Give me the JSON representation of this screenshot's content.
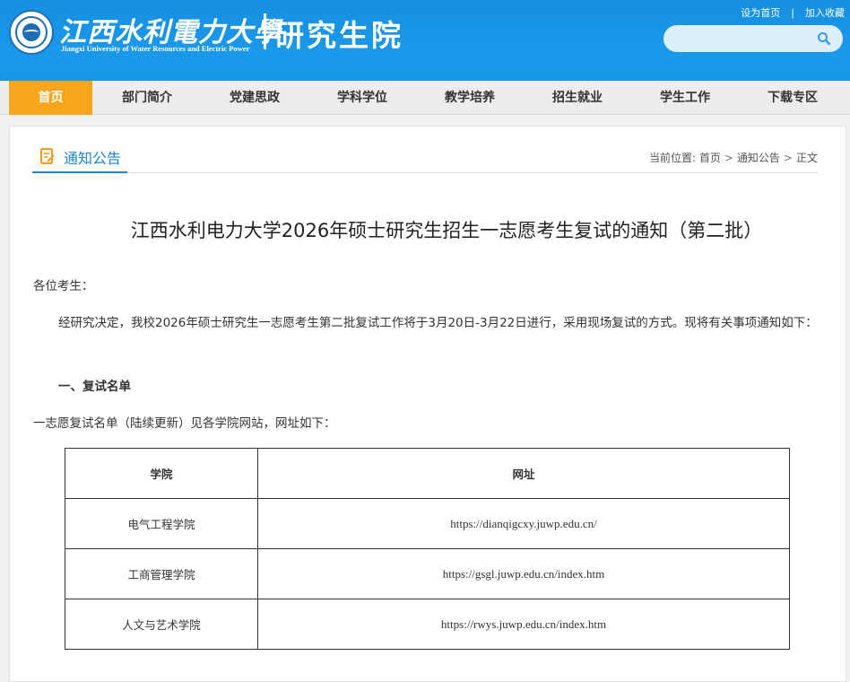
{
  "header": {
    "school_name_cn": "江西水利電力大學",
    "school_name_en": "Jiangxi University of Water Resources and Electric Power",
    "dept_name": "研究生院",
    "top_links": [
      "设为首页",
      "加入收藏"
    ],
    "search": {
      "value": "",
      "placeholder": ""
    }
  },
  "nav": {
    "items": [
      "首页",
      "部门简介",
      "党建思政",
      "学科学位",
      "教学培养",
      "招生就业",
      "学生工作",
      "下载专区"
    ],
    "active_index": 0
  },
  "section": {
    "title": "通知公告",
    "breadcrumb_prefix": "当前位置:",
    "breadcrumb": [
      "首页",
      "通知公告",
      "正文"
    ]
  },
  "article": {
    "title": "江西水利电力大学2026年硕士研究生招生一志愿考生复试的通知（第二批）",
    "greeting": "各位考生：",
    "intro": "经研究决定，我校2026年硕士研究生一志愿考生第二批复试工作将于3月20日-3月22日进行，采用现场复试的方式。现将有关事项通知如下：",
    "heading1": "一、复试名单",
    "list_note": "一志愿复试名单（陆续更新）见各学院网站，网址如下：",
    "table": {
      "headers": [
        "学院",
        "网址"
      ],
      "rows": [
        [
          "电气工程学院",
          "https://dianqigcxy.juwp.edu.cn/"
        ],
        [
          "工商管理学院",
          "https://gsgl.juwp.edu.cn/index.htm"
        ],
        [
          "人文与艺术学院",
          "https://rwys.juwp.edu.cn/index.htm"
        ]
      ]
    }
  },
  "colors": {
    "header_blue": "#1a96e6",
    "nav_active": "#f7a51c",
    "accent_blue": "#1e84d8"
  },
  "icons": {
    "search": "search-icon",
    "section": "notice-edit-icon"
  }
}
